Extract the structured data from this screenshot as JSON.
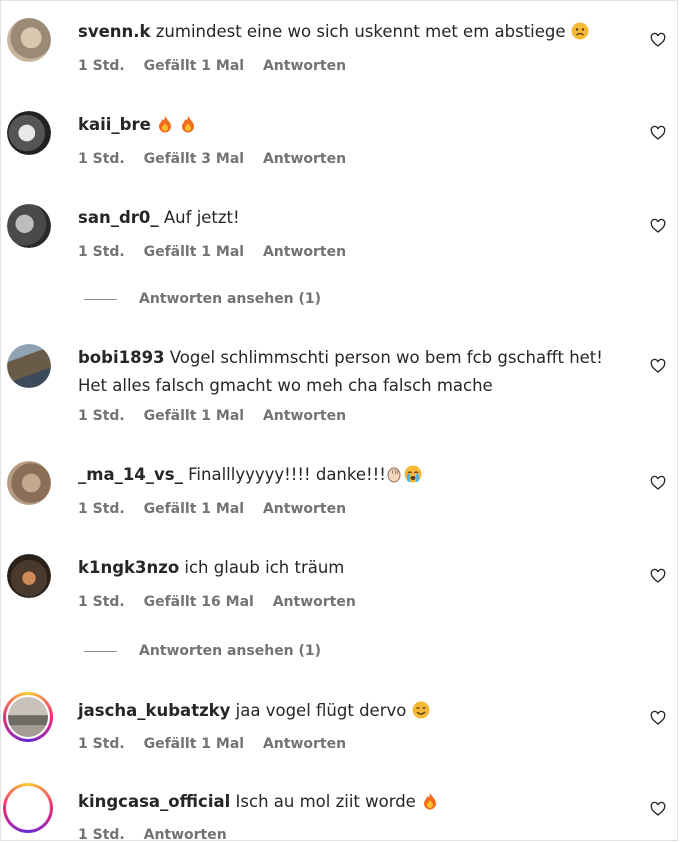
{
  "comments": [
    {
      "username": "svenn.k",
      "text": "zumindest eine wo sich uskennt met em abstiege",
      "time": "1 Std.",
      "likes": "Gefällt 1 Mal",
      "reply": "Antworten"
    },
    {
      "username": "kaii_bre",
      "text": "",
      "time": "1 Std.",
      "likes": "Gefällt 3 Mal",
      "reply": "Antworten"
    },
    {
      "username": "san_dr0_",
      "text": "Auf jetzt!",
      "time": "1 Std.",
      "likes": "Gefällt 1 Mal",
      "reply": "Antworten"
    },
    {
      "username": "bobi1893",
      "text": "Vogel schlimmschti person wo bem fcb gschafft het!",
      "text2": "Het alles falsch gmacht wo meh cha falsch mache",
      "time": "1 Std.",
      "likes": "Gefällt 1 Mal",
      "reply": "Antworten"
    },
    {
      "username": "_ma_14_vs_",
      "text": "Finalllyyyyy!!!! danke!!!",
      "time": "1 Std.",
      "likes": "Gefällt 1 Mal",
      "reply": "Antworten"
    },
    {
      "username": "k1ngk3nzo",
      "text": "ich glaub ich träum",
      "time": "1 Std.",
      "likes": "Gefällt 16 Mal",
      "reply": "Antworten"
    },
    {
      "username": "jascha_kubatzky",
      "text": "jaa vogel flügt dervo",
      "time": "1 Std.",
      "likes": "Gefällt 1 Mal",
      "reply": "Antworten"
    },
    {
      "username": "kingcasa_official",
      "text": "Isch au mol ziit worde",
      "time": "1 Std.",
      "likes": "",
      "reply": "Antworten"
    }
  ],
  "view_replies": [
    "Antworten ansehen (1)",
    "Antworten ansehen (1)"
  ],
  "icons": {
    "like": "heart-outline-icon",
    "fire": "fire-emoji-icon",
    "sad": "sad-face-emoji-icon",
    "clap": "clapping-hands-emoji-icon",
    "cry": "crying-face-emoji-icon",
    "smile": "smiling-face-emoji-icon"
  },
  "colors": {
    "text": "#262626",
    "meta": "#737373",
    "story_ring": "#ee2a7b"
  }
}
